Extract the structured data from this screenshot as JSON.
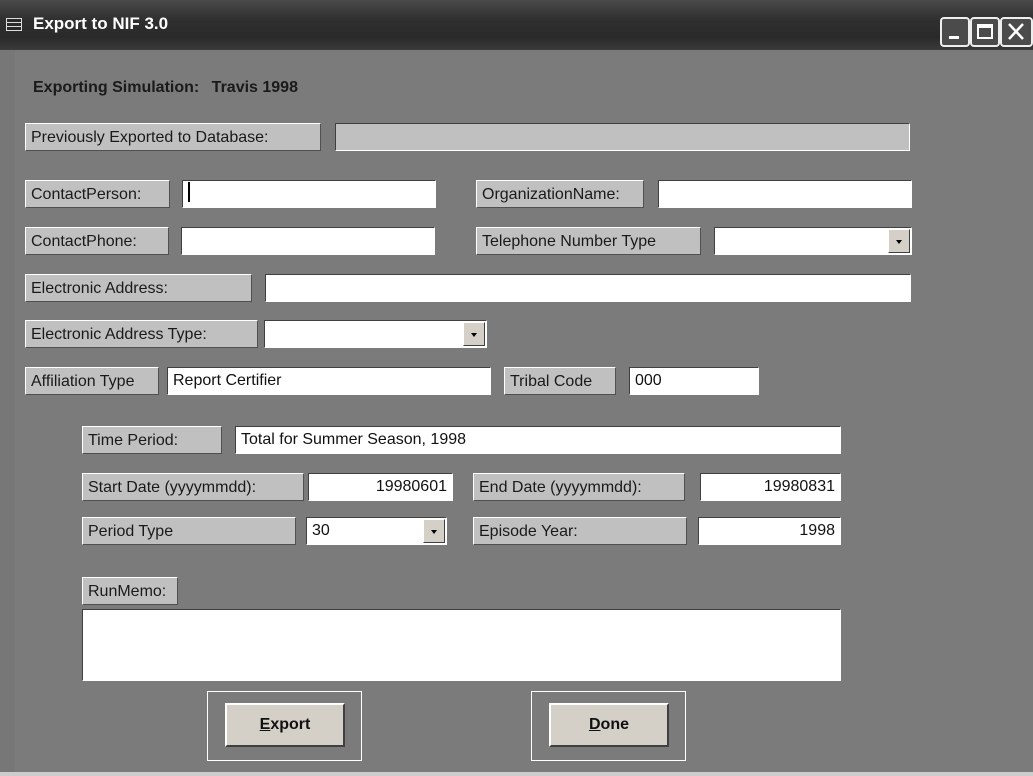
{
  "window": {
    "title": "Export to NIF 3.0"
  },
  "heading": {
    "label": "Exporting Simulation:",
    "value": "Travis 1998"
  },
  "fields": {
    "previously_exported_label": "Previously Exported to Database:",
    "previously_exported_value": "",
    "contact_person_label": "ContactPerson:",
    "contact_person_value": "",
    "organization_name_label": "OrganizationName:",
    "organization_name_value": "",
    "contact_phone_label": "ContactPhone:",
    "contact_phone_value": "",
    "telephone_type_label": "Telephone Number Type",
    "telephone_type_value": "",
    "electronic_address_label": "Electronic Address:",
    "electronic_address_value": "",
    "electronic_address_type_label": "Electronic Address Type:",
    "electronic_address_type_value": "",
    "affiliation_type_label": "Affiliation Type",
    "affiliation_type_value": "Report Certifier",
    "tribal_code_label": "Tribal Code",
    "tribal_code_value": "000",
    "time_period_label": "Time Period:",
    "time_period_value": "Total for Summer Season, 1998",
    "start_date_label": "Start Date (yyyymmdd):",
    "start_date_value": "19980601",
    "end_date_label": "End Date (yyyymmdd):",
    "end_date_value": "19980831",
    "period_type_label": "Period Type",
    "period_type_value": "30",
    "episode_year_label": "Episode Year:",
    "episode_year_value": "1998",
    "run_memo_label": "RunMemo:",
    "run_memo_value": ""
  },
  "buttons": {
    "export_accel": "E",
    "export_rest": "xport",
    "done_accel": "D",
    "done_rest": "one"
  },
  "icons": [
    "form-icon",
    "minimize-icon",
    "maximize-icon",
    "close-icon",
    "chevron-down-icon"
  ]
}
